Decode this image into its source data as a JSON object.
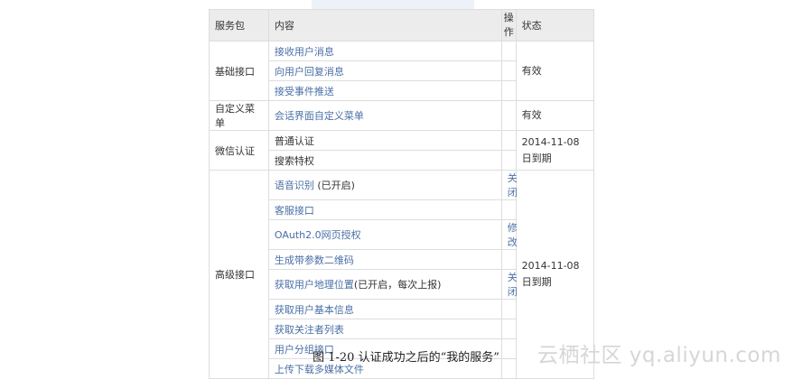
{
  "table": {
    "headers": {
      "package": "服务包",
      "content": "内容",
      "op_top": "操",
      "op_bottom": "作",
      "status": "状态"
    },
    "groups": [
      {
        "package": "基础接口",
        "status": "有效",
        "items": [
          {
            "name": "接收用户消息",
            "note": "",
            "action": ""
          },
          {
            "name": "向用户回复消息",
            "note": "",
            "action": ""
          },
          {
            "name": "接受事件推送",
            "note": "",
            "action": ""
          }
        ]
      },
      {
        "package": "自定义菜单",
        "status": "有效",
        "items": [
          {
            "name": "会话界面自定义菜单",
            "note": "",
            "action": ""
          }
        ]
      },
      {
        "package": "微信认证",
        "status": "2014-11-08日到期",
        "items": [
          {
            "name": "普通认证",
            "note": "",
            "action": ""
          },
          {
            "name": "搜索特权",
            "note": "",
            "action": ""
          }
        ]
      },
      {
        "package": "高级接口",
        "status": "2014-11-08日到期",
        "items": [
          {
            "name": "语音识别",
            "note": " (已开启)",
            "action": "关闭"
          },
          {
            "name": "客服接口",
            "note": "",
            "action": ""
          },
          {
            "name": "OAuth2.0网页授权",
            "note": "",
            "action": "修改"
          },
          {
            "name": "生成带参数二维码",
            "note": "",
            "action": ""
          },
          {
            "name": "获取用户地理位置",
            "note": "(已开启，每次上报)",
            "action": "关闭"
          },
          {
            "name": "获取用户基本信息",
            "note": "",
            "action": ""
          },
          {
            "name": "获取关注者列表",
            "note": "",
            "action": ""
          },
          {
            "name": "用户分组接口",
            "note": "",
            "action": ""
          },
          {
            "name": "上传下载多媒体文件",
            "note": "",
            "action": ""
          }
        ]
      }
    ]
  },
  "caption": "图 1-20    认证成功之后的“我的服务”",
  "watermark": "云栖社区 yq.aliyun.com"
}
